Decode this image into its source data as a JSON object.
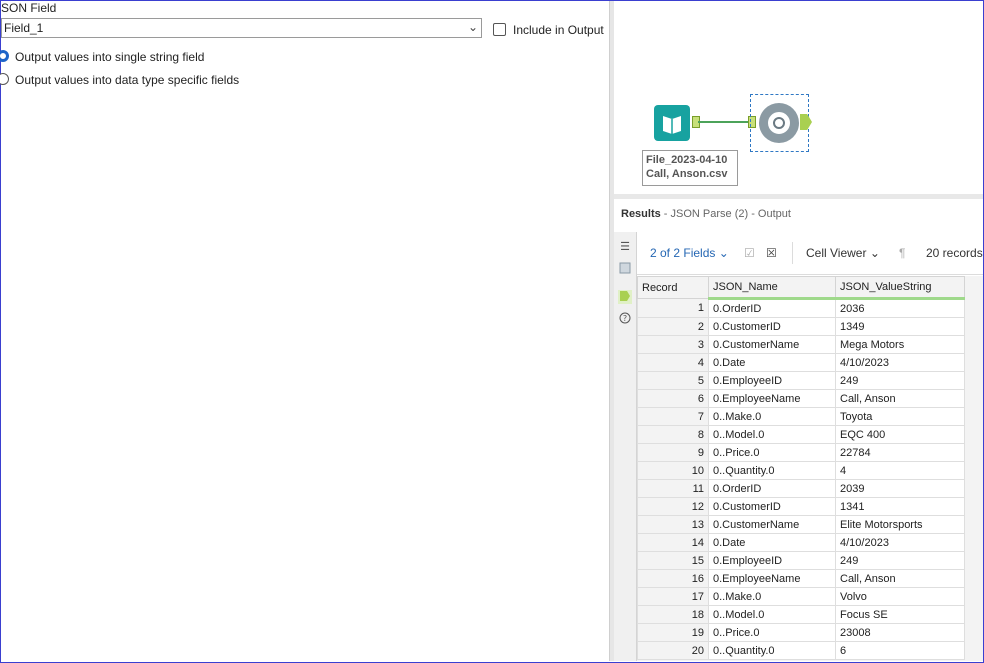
{
  "config": {
    "json_field_label": "SON Field",
    "json_field_value": "Field_1",
    "include_output_label": "Include in Output",
    "radio_single": "Output values into single string field",
    "radio_typed": "Output values into data type specific fields"
  },
  "canvas": {
    "annotation_line1": "File_2023-04-10",
    "annotation_line2": "Call, Anson.csv"
  },
  "results": {
    "title": "Results",
    "subtitle": " - JSON Parse (2) - Output",
    "fields_label": "2 of 2 Fields",
    "cell_viewer_label": "Cell Viewer",
    "records_label": "20 records",
    "columns": [
      "Record",
      "JSON_Name",
      "JSON_ValueString"
    ],
    "rows": [
      {
        "record": "1",
        "name": "0.OrderID",
        "value": "2036"
      },
      {
        "record": "2",
        "name": "0.CustomerID",
        "value": "1349"
      },
      {
        "record": "3",
        "name": "0.CustomerName",
        "value": "Mega Motors"
      },
      {
        "record": "4",
        "name": "0.Date",
        "value": "4/10/2023"
      },
      {
        "record": "5",
        "name": "0.EmployeeID",
        "value": "249"
      },
      {
        "record": "6",
        "name": "0.EmployeeName",
        "value": "Call, Anson"
      },
      {
        "record": "7",
        "name": "0..Make.0",
        "value": "Toyota"
      },
      {
        "record": "8",
        "name": "0..Model.0",
        "value": "EQC 400"
      },
      {
        "record": "9",
        "name": "0..Price.0",
        "value": "22784"
      },
      {
        "record": "10",
        "name": "0..Quantity.0",
        "value": "4"
      },
      {
        "record": "11",
        "name": "0.OrderID",
        "value": "2039"
      },
      {
        "record": "12",
        "name": "0.CustomerID",
        "value": "1341"
      },
      {
        "record": "13",
        "name": "0.CustomerName",
        "value": "Elite Motorsports"
      },
      {
        "record": "14",
        "name": "0.Date",
        "value": "4/10/2023"
      },
      {
        "record": "15",
        "name": "0.EmployeeID",
        "value": "249"
      },
      {
        "record": "16",
        "name": "0.EmployeeName",
        "value": "Call, Anson"
      },
      {
        "record": "17",
        "name": "0..Make.0",
        "value": "Volvo"
      },
      {
        "record": "18",
        "name": "0..Model.0",
        "value": "Focus SE"
      },
      {
        "record": "19",
        "name": "0..Price.0",
        "value": "23008"
      },
      {
        "record": "20",
        "name": "0..Quantity.0",
        "value": "6"
      }
    ]
  }
}
